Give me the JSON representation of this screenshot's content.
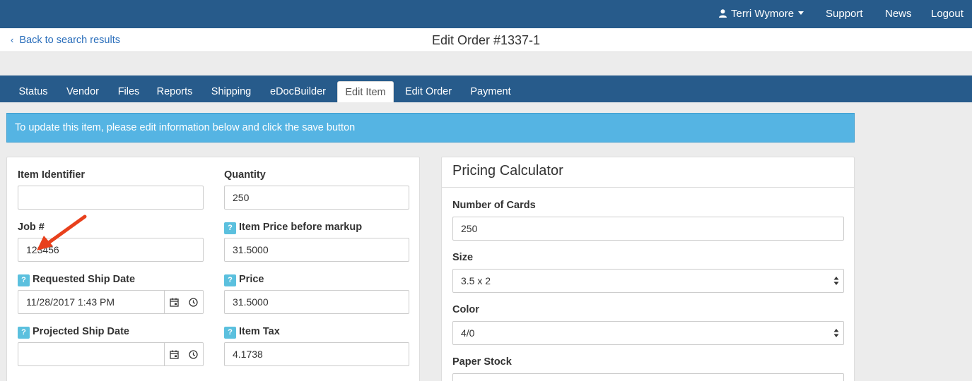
{
  "topnav": {
    "user_name": "Terri Wymore",
    "links": [
      "Support",
      "News",
      "Logout"
    ],
    "bg_color": "#275b8b"
  },
  "subheader": {
    "back_label": "Back to search results",
    "title": "Edit Order #1337-1"
  },
  "tabs": [
    "Status",
    "Vendor",
    "Files",
    "Reports",
    "Shipping",
    "eDocBuilder",
    "Edit Item",
    "Edit Order",
    "Payment"
  ],
  "active_tab": "Edit Item",
  "alert": {
    "text": "To update this item, please edit information below and click the save button",
    "color": "#55b4e3"
  },
  "item_form": {
    "item_identifier": {
      "label": "Item Identifier",
      "value": ""
    },
    "quantity": {
      "label": "Quantity",
      "value": "250"
    },
    "job_number": {
      "label": "Job #",
      "value": "123456"
    },
    "item_price_before_markup": {
      "label": "Item Price before markup",
      "value": "31.5000"
    },
    "requested_ship_date": {
      "label": "Requested Ship Date",
      "value": "11/28/2017 1:43 PM"
    },
    "price": {
      "label": "Price",
      "value": "31.5000"
    },
    "projected_ship_date": {
      "label": "Projected Ship Date",
      "value": ""
    },
    "item_tax": {
      "label": "Item Tax",
      "value": "4.1738"
    },
    "help_glyph": "?"
  },
  "pricing": {
    "title": "Pricing Calculator",
    "number_of_cards": {
      "label": "Number of Cards",
      "value": "250"
    },
    "size": {
      "label": "Size",
      "value": "3.5 x 2"
    },
    "color": {
      "label": "Color",
      "value": "4/0"
    },
    "paper_stock": {
      "label": "Paper Stock"
    }
  },
  "annotation": {
    "color": "#e8401c"
  }
}
